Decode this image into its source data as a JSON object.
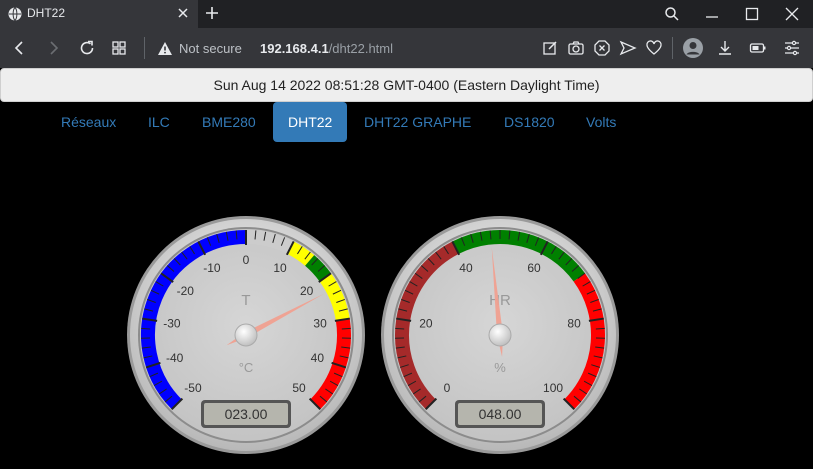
{
  "browser": {
    "tab_title": "DHT22",
    "new_tab_symbol": "+",
    "security_label": "Not secure",
    "url_host": "192.168.4.1",
    "url_path": "/dht22.html"
  },
  "page": {
    "datetime": "Sun Aug 14 2022 08:51:28 GMT-0400 (Eastern Daylight Time)",
    "nav": [
      {
        "label": "Réseaux",
        "active": false
      },
      {
        "label": "ILC",
        "active": false
      },
      {
        "label": "BME280",
        "active": false
      },
      {
        "label": "DHT22",
        "active": true
      },
      {
        "label": "DHT22 GRAPHE",
        "active": false
      },
      {
        "label": "DS1820",
        "active": false
      },
      {
        "label": "Volts",
        "active": false
      }
    ]
  },
  "gauges": [
    {
      "title": "T",
      "units": "°C",
      "value": 23,
      "value_text": "023.00",
      "min": -50,
      "max": 50,
      "major_ticks": [
        "-50",
        "-40",
        "-30",
        "-20",
        "-10",
        "0",
        "10",
        "20",
        "30",
        "40",
        "50"
      ],
      "highlights": [
        {
          "from": -50,
          "to": 0,
          "color": "#0000ff"
        },
        {
          "from": 0,
          "to": 10,
          "color": "#cccccc"
        },
        {
          "from": 10,
          "to": 15,
          "color": "#ffff00"
        },
        {
          "from": 15,
          "to": 20,
          "color": "#008000"
        },
        {
          "from": 20,
          "to": 30,
          "color": "#ffff00"
        },
        {
          "from": 30,
          "to": 50,
          "color": "#ff0000"
        }
      ]
    },
    {
      "title": "HR",
      "units": "%",
      "value": 48,
      "value_text": "048.00",
      "min": 0,
      "max": 100,
      "major_ticks": [
        "0",
        "20",
        "40",
        "60",
        "80",
        "100"
      ],
      "highlights": [
        {
          "from": 0,
          "to": 40,
          "color": "#a52a2a"
        },
        {
          "from": 40,
          "to": 70,
          "color": "#008000"
        },
        {
          "from": 70,
          "to": 100,
          "color": "#ff0000"
        }
      ]
    }
  ],
  "colors": {
    "nav_link": "#337ab7",
    "nav_active_bg": "#337ab7",
    "needle": "#f0a090"
  }
}
